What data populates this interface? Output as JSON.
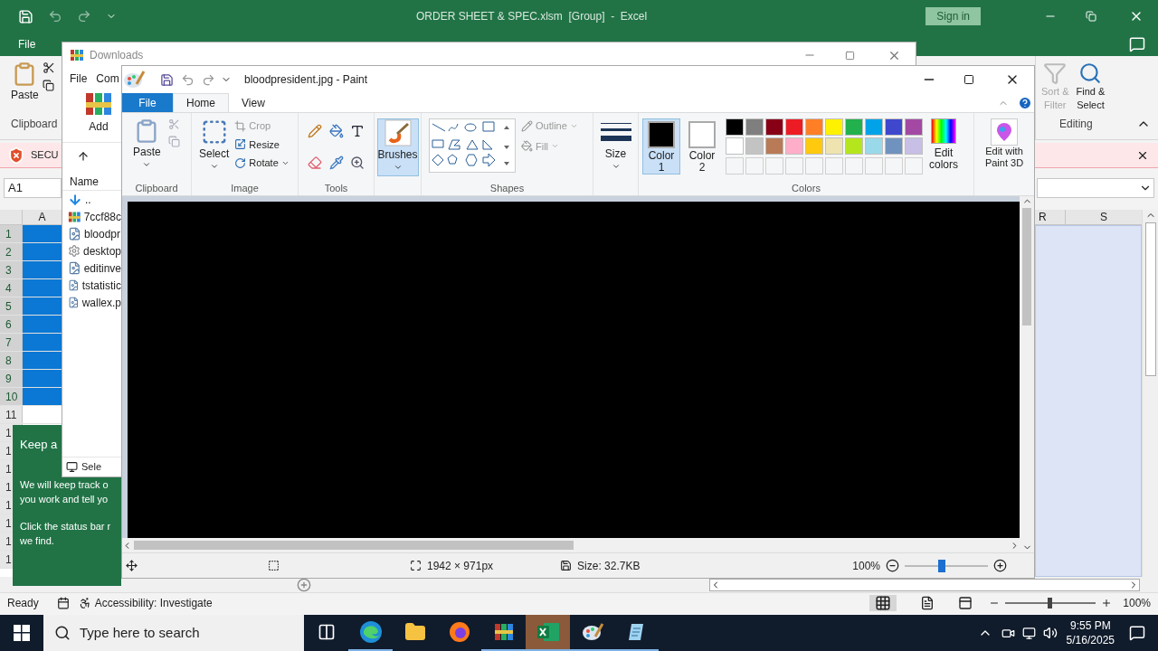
{
  "excel": {
    "title": "ORDER SHEET & SPEC.xlsm  [Group]  -  Excel",
    "sign_in": "Sign in",
    "tabs": [
      {
        "label": "File"
      }
    ],
    "paste": "Paste",
    "clipboard_group": "Clipboard",
    "sort_filter": {
      "lines": [
        "Sort &",
        "Filter"
      ],
      "disabled": true
    },
    "find_select": {
      "lines": [
        "Find &",
        "Select"
      ],
      "disabled": false
    },
    "editing_group": "Editing",
    "security_bar": "SECU",
    "name_box": "A1",
    "columns": [
      "A",
      "R",
      "S"
    ],
    "rows": [
      {
        "label": "1",
        "selected": true
      },
      {
        "label": "2",
        "selected": true
      },
      {
        "label": "3",
        "selected": true
      },
      {
        "label": "4",
        "selected": true
      },
      {
        "label": "5",
        "selected": true
      },
      {
        "label": "6",
        "selected": true
      },
      {
        "label": "7",
        "selected": true
      },
      {
        "label": "8",
        "selected": true
      },
      {
        "label": "9",
        "selected": true
      },
      {
        "label": "10",
        "selected": true
      },
      {
        "label": "11",
        "selected": false
      },
      {
        "label": "1",
        "selected": false
      },
      {
        "label": "1",
        "selected": false
      },
      {
        "label": "1",
        "selected": false
      },
      {
        "label": "1",
        "selected": false
      },
      {
        "label": "1",
        "selected": false
      },
      {
        "label": "1",
        "selected": false
      },
      {
        "label": "1",
        "selected": false
      },
      {
        "label": "1",
        "selected": false
      }
    ],
    "status": {
      "ready": "Ready",
      "accessibility": "Accessibility: Investigate",
      "zoom": "100%",
      "level": 0.5
    }
  },
  "callout": {
    "title": "Keep a",
    "paragraphs": [
      [
        "We will keep track o",
        "you work and tell yo"
      ],
      [
        "Click the status bar r",
        "we find."
      ]
    ]
  },
  "downloads": {
    "title": "Downloads",
    "menu": [
      "File",
      "Com"
    ],
    "add": "Add",
    "column": "Name",
    "files": [
      {
        "name": "..",
        "kind": "up"
      },
      {
        "name": "7ccf88c",
        "kind": "archive"
      },
      {
        "name": "bloodpr",
        "kind": "image"
      },
      {
        "name": "desktop",
        "kind": "settings"
      },
      {
        "name": "editinve",
        "kind": "image"
      },
      {
        "name": "tstatistic",
        "kind": "image"
      },
      {
        "name": "wallex.p",
        "kind": "image"
      }
    ],
    "status": "Sele"
  },
  "paint": {
    "title": "bloodpresident.jpg - Paint",
    "tabs": [
      {
        "label": "File",
        "kind": "file",
        "selected": false
      },
      {
        "label": "Home",
        "kind": "tab",
        "selected": true
      },
      {
        "label": "View",
        "kind": "tab",
        "selected": false
      }
    ],
    "clipboard": {
      "paste": "Paste",
      "group": "Clipboard"
    },
    "image": {
      "select": "Select",
      "crop": "Crop",
      "resize": "Resize",
      "rotate": "Rotate",
      "group": "Image"
    },
    "tools_group": "Tools",
    "brushes": {
      "label": "Brushes",
      "selected": true
    },
    "shapes": {
      "outline": "Outline",
      "fill": "Fill",
      "group": "Shapes"
    },
    "size": "Size",
    "color1": {
      "lines": [
        "Color",
        "1"
      ],
      "color": "#000000",
      "selected": true
    },
    "color2": {
      "lines": [
        "Color",
        "2"
      ],
      "color": "#ffffff",
      "selected": false
    },
    "palette": [
      {
        "color": "#000000"
      },
      {
        "color": "#7f7f7f"
      },
      {
        "color": "#880015"
      },
      {
        "color": "#ed1c24"
      },
      {
        "color": "#ff7f27"
      },
      {
        "color": "#fff200"
      },
      {
        "color": "#22b14c"
      },
      {
        "color": "#00a2e8"
      },
      {
        "color": "#3f48cc"
      },
      {
        "color": "#a349a4"
      },
      {
        "color": "#ffffff"
      },
      {
        "color": "#c3c3c3"
      },
      {
        "color": "#b97a57"
      },
      {
        "color": "#ffaec9"
      },
      {
        "color": "#ffc90e"
      },
      {
        "color": "#efe4b0"
      },
      {
        "color": "#b5e61d"
      },
      {
        "color": "#99d9ea"
      },
      {
        "color": "#7092be"
      },
      {
        "color": "#c8bfe7"
      }
    ],
    "edit_colors": [
      "Edit",
      "colors"
    ],
    "colors_group": "Colors",
    "paint3d": [
      "Edit with",
      "Paint 3D"
    ],
    "status": {
      "dimensions": "1942 × 971px",
      "size": "Size: 32.7KB",
      "zoom": "100%",
      "level": 0.45
    }
  },
  "taskbar": {
    "search": "Type here to search",
    "apps": [
      {
        "kind": "taskview",
        "running": false,
        "selected": false
      },
      {
        "kind": "edge",
        "running": true,
        "selected": false
      },
      {
        "kind": "explorer",
        "running": false,
        "selected": false
      },
      {
        "kind": "firefox",
        "running": false,
        "selected": false
      },
      {
        "kind": "winrar",
        "running": true,
        "selected": false
      },
      {
        "kind": "excel",
        "running": true,
        "selected": true
      },
      {
        "kind": "paint",
        "running": true,
        "selected": false
      },
      {
        "kind": "notepad",
        "running": true,
        "selected": false
      }
    ],
    "time": "9:55 PM",
    "date": "5/16/2025"
  }
}
